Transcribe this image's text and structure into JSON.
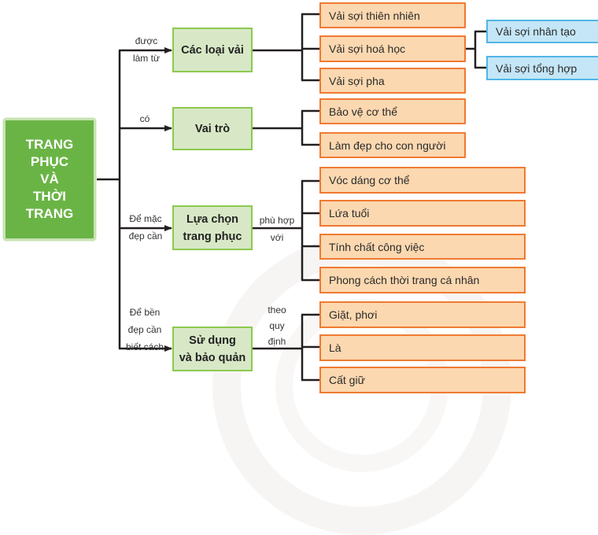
{
  "root": {
    "label": "TRANG\nPHỤC\nVÀ\nTHỜI\nTRANG",
    "color": "#6ab445"
  },
  "branches": [
    {
      "edge_label": "được\nlàm từ",
      "category": "Các loại vải",
      "relation": "",
      "items": [
        {
          "label": "Vải sợi thiên nhiên"
        },
        {
          "label": "Vải sợi hoá học",
          "children": [
            "Vải sợi nhân tạo",
            "Vải sợi tổng hợp"
          ]
        },
        {
          "label": "Vải sợi pha"
        }
      ]
    },
    {
      "edge_label": "có",
      "category": "Vai trò",
      "relation": "",
      "items": [
        {
          "label": "Bảo vệ cơ thể"
        },
        {
          "label": "Làm đẹp cho con người"
        }
      ]
    },
    {
      "edge_label": "Để mặc\nđẹp cần",
      "category": "Lựa chọn\ntrang phục",
      "relation": "phù hợp\nvới",
      "items": [
        {
          "label": "Vóc dáng cơ thể"
        },
        {
          "label": "Lứa tuổi"
        },
        {
          "label": "Tính chất công việc"
        },
        {
          "label": "Phong cách thời trang cá nhân"
        }
      ]
    },
    {
      "edge_label": "Để bền\nđẹp cần\nbiết cách",
      "category": "Sử dụng\nvà bảo quản",
      "relation": "theo\nquy\nđịnh",
      "items": [
        {
          "label": "Giặt, phơi"
        },
        {
          "label": "Là"
        },
        {
          "label": "Cất giữ"
        }
      ]
    }
  ],
  "colors": {
    "category_fill": "#d8e8c6",
    "category_border": "#8cc94f",
    "leaf_fill": "#fcd8b0",
    "leaf_border": "#ef7a32",
    "sub_fill": "#c4e6f7",
    "sub_border": "#4fb6e6",
    "line": "#231f20"
  }
}
